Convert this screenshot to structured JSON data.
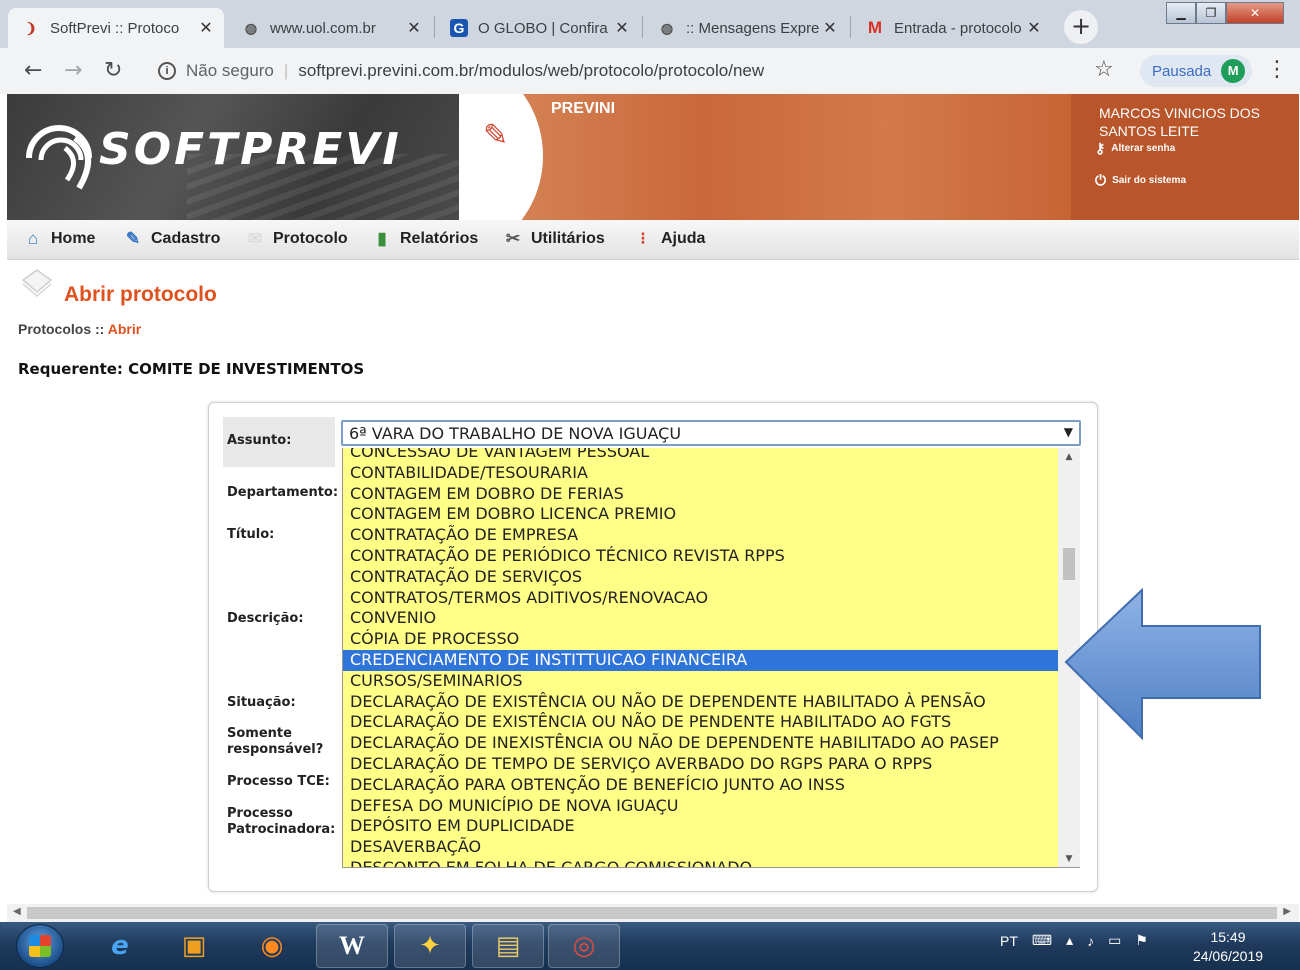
{
  "browser": {
    "tabs": [
      {
        "title": "SoftPrevi :: Protoco",
        "icon": "softprevi-icon"
      },
      {
        "title": "www.uol.com.br",
        "icon": "globe-icon"
      },
      {
        "title": "O GLOBO | Confira",
        "icon": "g-icon"
      },
      {
        "title": ":: Mensagens Expre",
        "icon": "globe-icon"
      },
      {
        "title": "Entrada - protocolo",
        "icon": "gmail-icon"
      }
    ],
    "security_label": "Não seguro",
    "url": "softprevi.previni.com.br/modulos/web/protocolo/protocolo/new",
    "profile_label": "Pausada",
    "profile_initial": "M"
  },
  "header": {
    "logo_text": "SOFTPREVI",
    "org_name": "PREVINI",
    "user_name": "MARCOS VINICIOS DOS SANTOS LEITE",
    "change_password": "Alterar senha",
    "logout": "Sair do sistema"
  },
  "menu": {
    "items": [
      {
        "label": "Home",
        "icon": "home-icon"
      },
      {
        "label": "Cadastro",
        "icon": "cadastro-icon"
      },
      {
        "label": "Protocolo",
        "icon": "protocolo-icon"
      },
      {
        "label": "Relatórios",
        "icon": "chart-icon"
      },
      {
        "label": "Utilitários",
        "icon": "tools-icon"
      },
      {
        "label": "Ajuda",
        "icon": "help-icon"
      }
    ]
  },
  "page": {
    "title": "Abrir protocolo",
    "breadcrumb_parent": "Protocolos",
    "breadcrumb_sep": " :: ",
    "breadcrumb_current": "Abrir",
    "requerente": "Requerente: COMITE DE INVESTIMENTOS"
  },
  "form": {
    "labels": {
      "assunto": "Assunto:",
      "departamento": "Departamento:",
      "titulo": "Título:",
      "descricao": "Descrição:",
      "situacao": "Situação:",
      "somente_responsavel": "Somente responsável?",
      "processo_tce": "Processo TCE:",
      "processo_patrocinadora": "Processo Patrocinadora:"
    },
    "assunto_value": "6ª VARA DO TRABALHO DE NOVA IGUAÇU",
    "assunto_options": [
      "CONCESSÃO DE VANTAGEM PESSOAL",
      "CONTABILIDADE/TESOURARIA",
      "CONTAGEM EM DOBRO DE FERIAS",
      "CONTAGEM EM DOBRO LICENCA PREMIO",
      "CONTRATAÇÃO DE EMPRESA",
      "CONTRATAÇÃO DE PERIÓDICO TÉCNICO REVISTA RPPS",
      "CONTRATAÇÃO DE SERVIÇOS",
      "CONTRATOS/TERMOS ADITIVOS/RENOVACAO",
      "CONVENIO",
      "CÓPIA DE PROCESSO",
      "CREDENCIAMENTO DE INSTITTUICAO FINANCEIRA",
      "CURSOS/SEMINARIOS",
      "DECLARAÇÃO DE EXISTÊNCIA OU NÃO DE DEPENDENTE HABILITADO À PENSÃO",
      "DECLARAÇÃO DE EXISTÊNCIA OU NÃO DE PENDENTE HABILITADO AO FGTS",
      "DECLARAÇÃO DE INEXISTÊNCIA OU NÃO DE DEPENDENTE HABILITADO AO PASEP",
      "DECLARAÇÃO DE TEMPO DE SERVIÇO AVERBADO DO RGPS PARA O RPPS",
      "DECLARAÇÃO PARA OBTENÇÃO DE BENEFÍCIO JUNTO AO INSS",
      "DEFESA DO MUNICÍPIO DE NOVA IGUAÇU",
      "DEPÓSITO EM DUPLICIDADE",
      "DESAVERBAÇÃO",
      "DESCONTO EM FOLHA DE CARGO COMISSIONADO"
    ],
    "highlighted_option": "CREDENCIAMENTO DE INSTITTUICAO FINANCEIRA"
  },
  "taskbar": {
    "language": "PT",
    "time": "15:49",
    "date": "24/06/2019"
  },
  "colors": {
    "accent_orange": "#e0521d",
    "dropdown_bg": "#ffff88",
    "highlight_blue": "#2f74d8"
  }
}
